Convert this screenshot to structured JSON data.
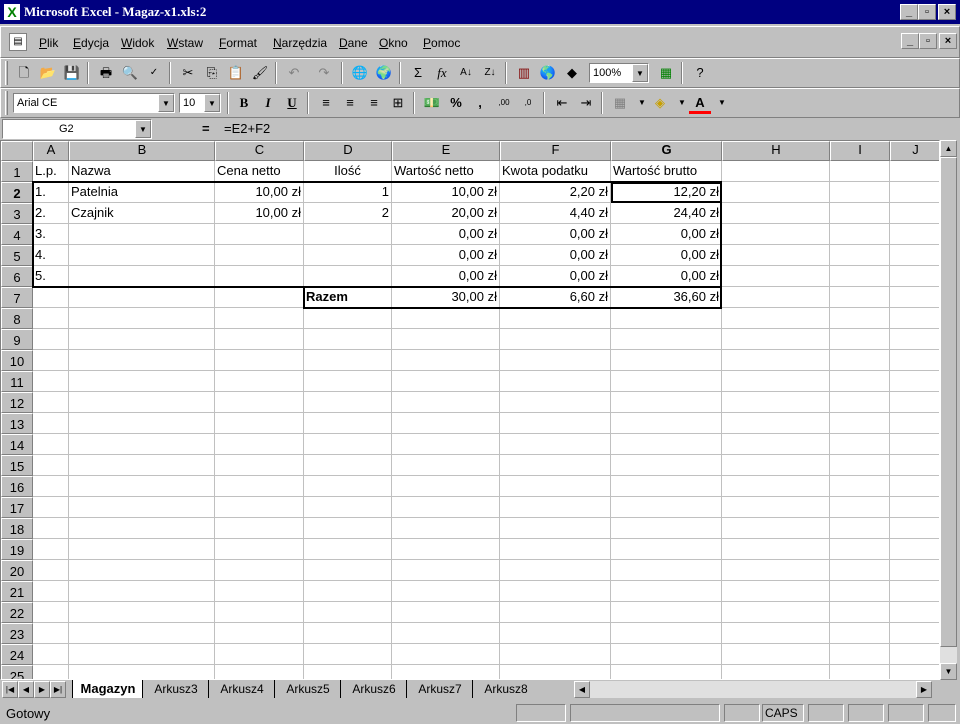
{
  "window": {
    "title": "Microsoft Excel - Magaz-x1.xls:2"
  },
  "menu": [
    {
      "label": "Plik"
    },
    {
      "label": "Edycja"
    },
    {
      "label": "Widok"
    },
    {
      "label": "Wstaw"
    },
    {
      "label": "Format"
    },
    {
      "label": "Narzędzia"
    },
    {
      "label": "Dane"
    },
    {
      "label": "Okno"
    },
    {
      "label": "Pomoc"
    }
  ],
  "toolbar": {
    "zoom": "100%"
  },
  "format_toolbar": {
    "font": "Arial CE",
    "size": "10",
    "bold": "B",
    "italic": "I",
    "underline": "U",
    "percent": "%",
    "comma": ",",
    "inc_dec": ",00",
    "dec_dec": ",0",
    "font_color": "A"
  },
  "formula_bar": {
    "name_box": "G2",
    "equals": "=",
    "formula": "=E2+F2"
  },
  "columns": [
    "A",
    "B",
    "C",
    "D",
    "E",
    "F",
    "G",
    "H",
    "I",
    "J"
  ],
  "rows": [
    "1",
    "2",
    "3",
    "4",
    "5",
    "6",
    "7",
    "8",
    "9",
    "10",
    "11",
    "12",
    "13",
    "14",
    "15",
    "16",
    "17",
    "18",
    "19",
    "20",
    "21",
    "22",
    "23",
    "24",
    "25"
  ],
  "table": {
    "headers": [
      "L.p.",
      "Nazwa",
      "Cena netto",
      "Ilość",
      "Wartość netto",
      "Kwota podatku",
      "Wartość brutto"
    ],
    "rows": [
      [
        "1.",
        "Patelnia",
        "10,00 zł",
        "1",
        "10,00 zł",
        "2,20 zł",
        "12,20 zł"
      ],
      [
        "2.",
        "Czajnik",
        "10,00 zł",
        "2",
        "20,00 zł",
        "4,40 zł",
        "24,40 zł"
      ],
      [
        "3.",
        "",
        "",
        "",
        "0,00 zł",
        "0,00 zł",
        "0,00 zł"
      ],
      [
        "4.",
        "",
        "",
        "",
        "0,00 zł",
        "0,00 zł",
        "0,00 zł"
      ],
      [
        "5.",
        "",
        "",
        "",
        "0,00 zł",
        "0,00 zł",
        "0,00 zł"
      ]
    ],
    "total": {
      "label": "Razem",
      "netto": "30,00 zł",
      "podatek": "6,60 zł",
      "brutto": "36,60 zł"
    }
  },
  "sheets": [
    {
      "label": "Magazyn",
      "active": true
    },
    {
      "label": "Arkusz3"
    },
    {
      "label": "Arkusz4"
    },
    {
      "label": "Arkusz5"
    },
    {
      "label": "Arkusz6"
    },
    {
      "label": "Arkusz7"
    },
    {
      "label": "Arkusz8"
    }
  ],
  "status": {
    "text": "Gotowy",
    "caps": "CAPS"
  }
}
